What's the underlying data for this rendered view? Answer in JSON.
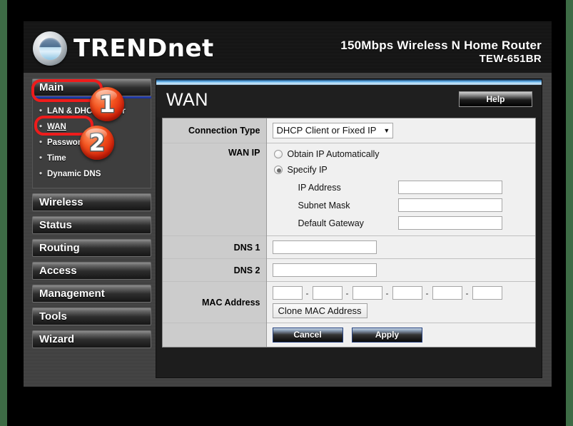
{
  "brand": {
    "name": "TRENDnet",
    "logo_icon": "trendnet-wave-logo-icon"
  },
  "header": {
    "model_line1": "150Mbps Wireless N Home Router",
    "model_line2": "TEW-651BR"
  },
  "sidebar": {
    "buttons": [
      {
        "label": "Main",
        "active": true
      },
      {
        "label": "Wireless",
        "active": false
      },
      {
        "label": "Status",
        "active": false
      },
      {
        "label": "Routing",
        "active": false
      },
      {
        "label": "Access",
        "active": false
      },
      {
        "label": "Management",
        "active": false
      },
      {
        "label": "Tools",
        "active": false
      },
      {
        "label": "Wizard",
        "active": false
      }
    ],
    "submenu": [
      {
        "label": "LAN & DHCP Server",
        "selected": false
      },
      {
        "label": "WAN",
        "selected": true
      },
      {
        "label": "Password",
        "selected": false
      },
      {
        "label": "Time",
        "selected": false
      },
      {
        "label": "Dynamic DNS",
        "selected": false
      }
    ]
  },
  "content": {
    "title": "WAN",
    "help_label": "Help"
  },
  "form": {
    "connection_type": {
      "label": "Connection Type",
      "value": "DHCP Client or Fixed IP",
      "arrow_icon": "chevron-down-icon",
      "options": [
        "DHCP Client or Fixed IP"
      ]
    },
    "wan_ip": {
      "label": "WAN IP",
      "radio_obtain": {
        "label": "Obtain IP Automatically",
        "checked": false
      },
      "radio_specify": {
        "label": "Specify IP",
        "checked": true
      },
      "fields": [
        {
          "label": "IP Address",
          "value": "",
          "placeholder": ""
        },
        {
          "label": "Subnet Mask",
          "value": "",
          "placeholder": ""
        },
        {
          "label": "Default Gateway",
          "value": "",
          "placeholder": ""
        }
      ]
    },
    "dns1": {
      "label": "DNS 1",
      "value": "",
      "placeholder": ""
    },
    "dns2": {
      "label": "DNS 2",
      "value": "",
      "placeholder": ""
    },
    "mac_address": {
      "label": "MAC Address",
      "separator": "-",
      "octets": [
        "",
        "",
        "",
        "",
        "",
        ""
      ],
      "clone_label": "Clone MAC Address"
    },
    "actions": {
      "cancel_label": "Cancel",
      "apply_label": "Apply"
    }
  },
  "annotations": {
    "badges": [
      {
        "number": "1"
      },
      {
        "number": "2"
      }
    ],
    "highlight_color": "#ee1c1c"
  },
  "colors": {
    "accent_blue": "#2a44b8",
    "badge_red": "#f4541f",
    "panel_dark": "#1d1d1d",
    "label_gray": "#cccccc",
    "field_gray": "#f0f0f0",
    "page_green_edge": "#3d6b45"
  }
}
